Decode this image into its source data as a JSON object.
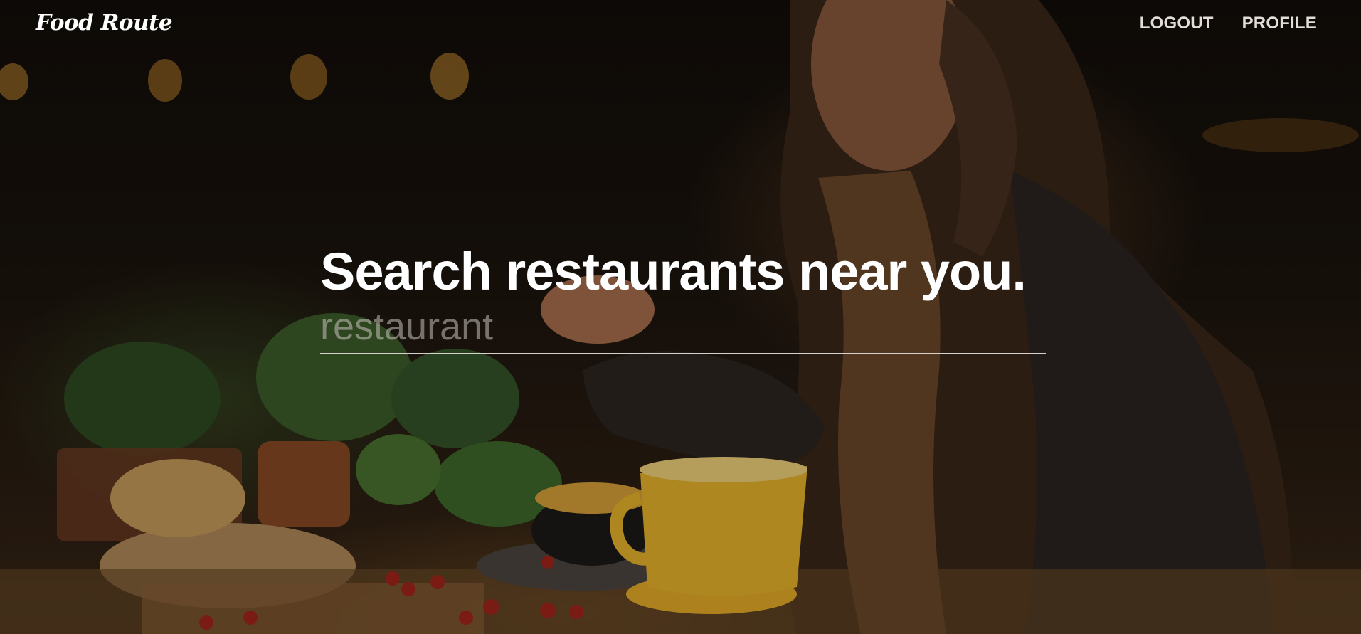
{
  "navbar": {
    "brand": "Food Route",
    "links": [
      {
        "label": "LOGOUT"
      },
      {
        "label": "PROFILE"
      }
    ]
  },
  "hero": {
    "headline": "Search restaurants near you.",
    "search": {
      "placeholder": "restaurant",
      "value": ""
    }
  },
  "colors": {
    "text_primary": "#ffffff",
    "nav_text": "#e2ddd7",
    "underline": "#d6d1cc",
    "placeholder": "#8e8a86",
    "background_dark": "#120d09"
  }
}
